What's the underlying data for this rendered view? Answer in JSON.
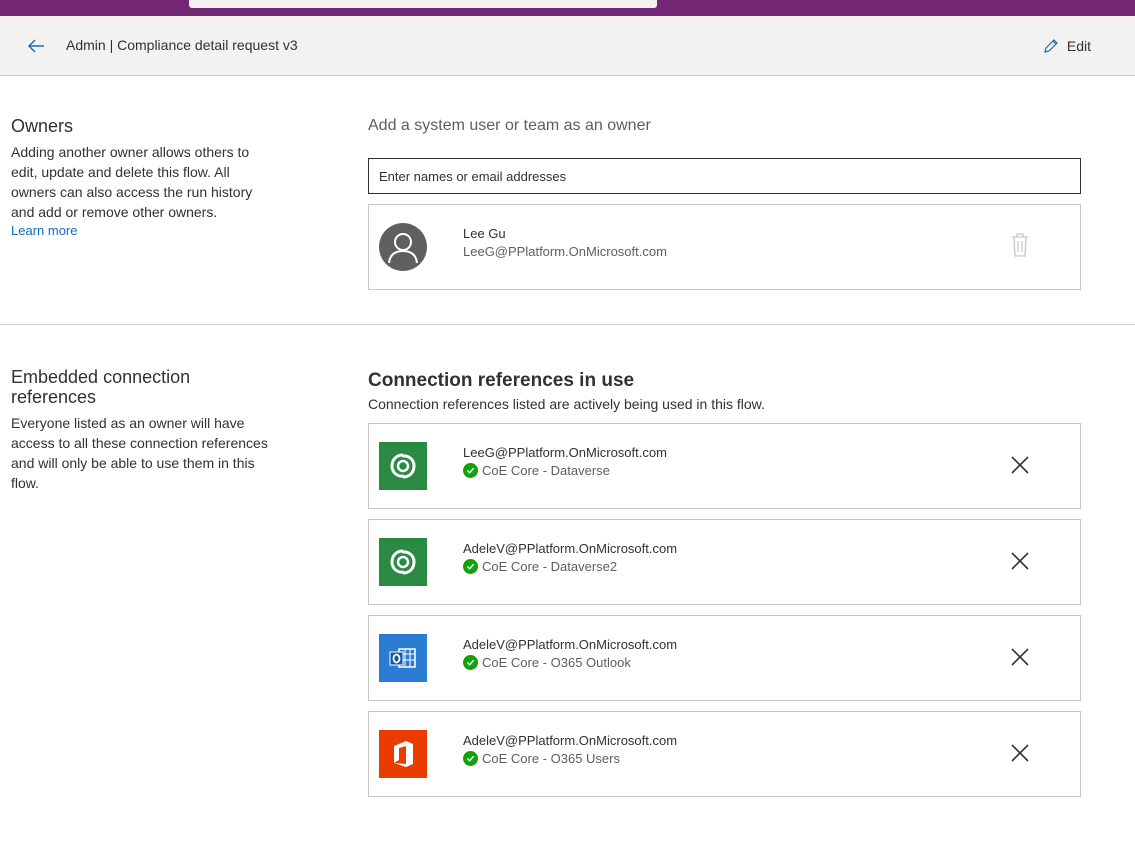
{
  "header": {
    "title": "Admin | Compliance detail request v3",
    "edit_label": "Edit",
    "back_icon": "back-arrow-icon"
  },
  "owners": {
    "heading": "Owners",
    "description": "Adding another owner allows others to edit, update and delete this flow. All owners can also access the run history and add or remove other owners.",
    "learn_more": "Learn more",
    "add_title": "Add a system user or team as an owner",
    "input_placeholder": "Enter names or email addresses",
    "list": [
      {
        "name": "Lee Gu",
        "email": "LeeG@PPlatform.OnMicrosoft.com"
      }
    ]
  },
  "embedded": {
    "heading": "Embedded connection references",
    "description": "Everyone listed as an owner will have access to all these connection references and will only be able to use them in this flow."
  },
  "connections": {
    "heading": "Connection references in use",
    "description": "Connection references listed are actively being used in this flow.",
    "items": [
      {
        "account": "LeeG@PPlatform.OnMicrosoft.com",
        "name": "CoE Core - Dataverse",
        "icon": "dataverse-icon",
        "color": "#2a8a44"
      },
      {
        "account": "AdeleV@PPlatform.OnMicrosoft.com",
        "name": "CoE Core - Dataverse2",
        "icon": "dataverse-icon",
        "color": "#2a8a44"
      },
      {
        "account": "AdeleV@PPlatform.OnMicrosoft.com",
        "name": "CoE Core - O365 Outlook",
        "icon": "outlook-icon",
        "color": "#2b7cd3"
      },
      {
        "account": "AdeleV@PPlatform.OnMicrosoft.com",
        "name": "CoE Core - O365 Users",
        "icon": "office-icon",
        "color": "#eb3c00"
      }
    ]
  },
  "colors": {
    "suite_bar": "#742774",
    "command_bar": "#f3f2f1",
    "link": "#0f6cbd",
    "status_ok": "#13a10e"
  }
}
